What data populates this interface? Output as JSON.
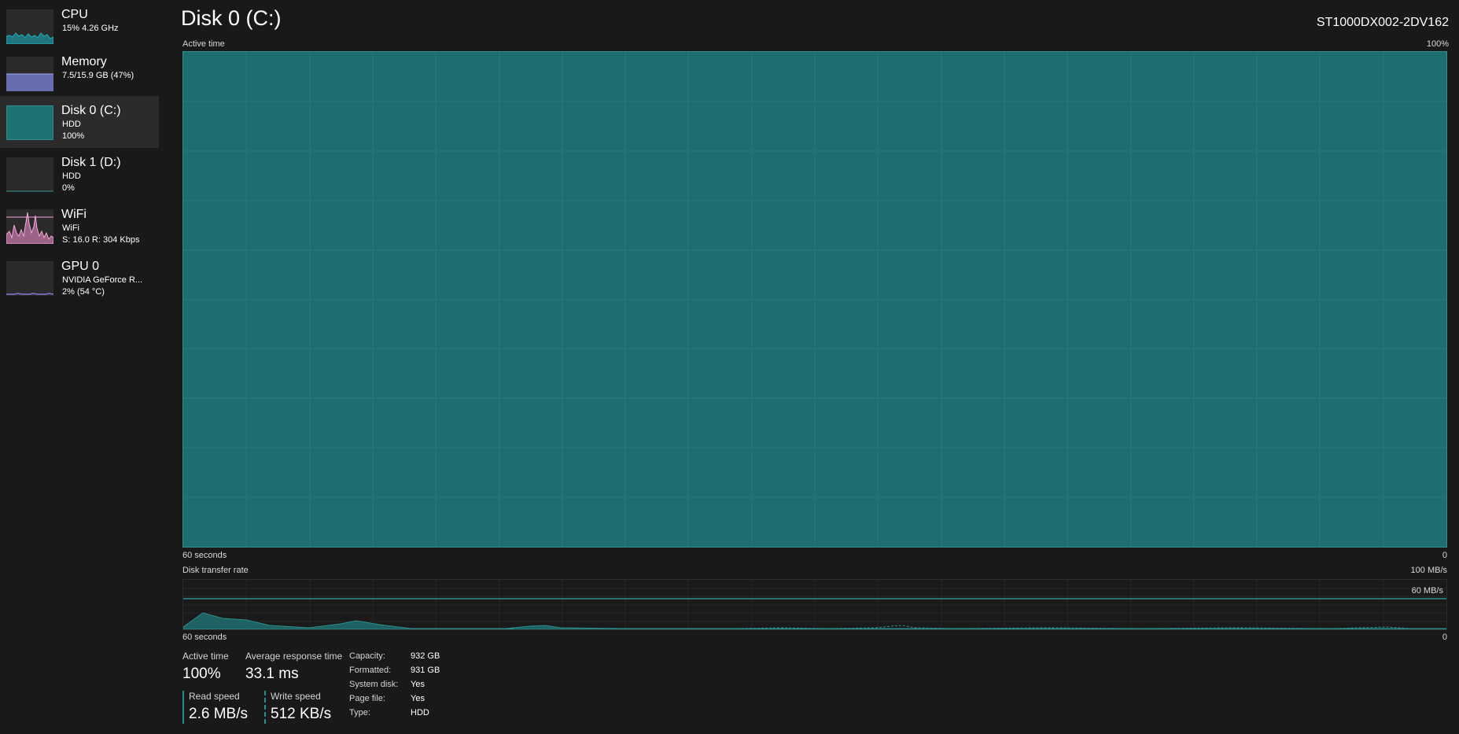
{
  "sidebar": {
    "items": [
      {
        "title": "CPU",
        "line1": "15%  4.26 GHz",
        "line2": ""
      },
      {
        "title": "Memory",
        "line1": "7.5/15.9 GB (47%)",
        "line2": ""
      },
      {
        "title": "Disk 0 (C:)",
        "line1": "HDD",
        "line2": "100%"
      },
      {
        "title": "Disk 1 (D:)",
        "line1": "HDD",
        "line2": "0%"
      },
      {
        "title": "WiFi",
        "line1": "WiFi",
        "line2": "S: 16.0  R: 304 Kbps"
      },
      {
        "title": "GPU 0",
        "line1": "NVIDIA GeForce R...",
        "line2": "2%  (54 °C)"
      }
    ],
    "selected_index": 2,
    "thumb_colors": [
      "#1ab2c0",
      "#7b86d9",
      "#1e7272",
      "#2a2a2a",
      "#e78bc6",
      "#8a74d6"
    ]
  },
  "header": {
    "title": "Disk 0 (C:)",
    "model": "ST1000DX002-2DV162"
  },
  "active_time_graph": {
    "label": "Active time",
    "max_label": "100%",
    "x_left_label": "60 seconds",
    "x_right_label": "0",
    "fill_color": "#1e6e70",
    "value_percent": 100
  },
  "transfer_graph": {
    "label": "Disk transfer rate",
    "max_label": "100 MB/s",
    "ref_label": "60 MB/s",
    "x_left_label": "60 seconds",
    "x_right_label": "0",
    "line_color": "#2b8f8c"
  },
  "stats": {
    "active_time": {
      "label": "Active time",
      "value": "100%"
    },
    "avg_response": {
      "label": "Average response time",
      "value": "33.1 ms"
    },
    "read_speed": {
      "label": "Read speed",
      "value": "2.6 MB/s"
    },
    "write_speed": {
      "label": "Write speed",
      "value": "512 KB/s"
    }
  },
  "properties": [
    {
      "label": "Capacity:",
      "value": "932 GB"
    },
    {
      "label": "Formatted:",
      "value": "931 GB"
    },
    {
      "label": "System disk:",
      "value": "Yes"
    },
    {
      "label": "Page file:",
      "value": "Yes"
    },
    {
      "label": "Type:",
      "value": "HDD"
    }
  ]
}
